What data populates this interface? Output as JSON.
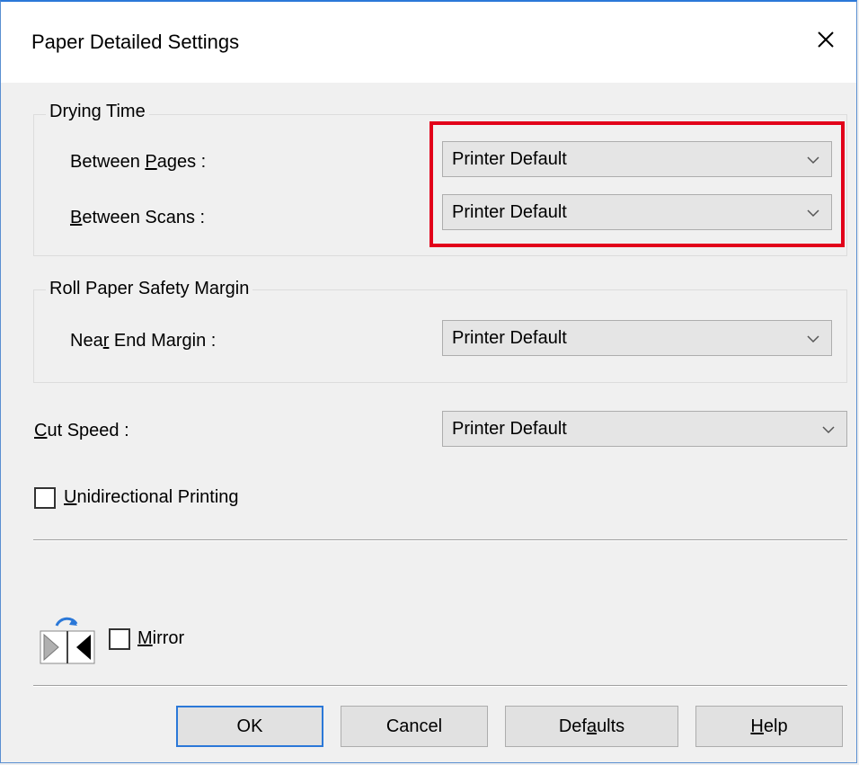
{
  "window": {
    "title": "Paper Detailed Settings"
  },
  "drying_time": {
    "legend": "Drying Time",
    "between_pages": {
      "label_pre": "Between ",
      "label_key": "P",
      "label_post": "ages :",
      "value": "Printer Default"
    },
    "between_scans": {
      "label_pre": "",
      "label_key": "B",
      "label_post": "etween Scans :",
      "value": "Printer Default"
    }
  },
  "roll_paper": {
    "legend": "Roll Paper Safety Margin",
    "near_end": {
      "label_pre": "Nea",
      "label_key": "r",
      "label_post": " End Margin :",
      "value": "Printer Default"
    }
  },
  "cut_speed": {
    "label_pre": "",
    "label_key": "C",
    "label_post": "ut Speed :",
    "value": "Printer Default"
  },
  "unidirectional": {
    "label_pre": "",
    "label_key": "U",
    "label_post": "nidirectional Printing",
    "checked": false
  },
  "mirror": {
    "label_pre": "",
    "label_key": "M",
    "label_post": "irror",
    "checked": false
  },
  "buttons": {
    "ok": "OK",
    "cancel": "Cancel",
    "defaults_pre": "Def",
    "defaults_key": "a",
    "defaults_post": "ults",
    "help_pre": "",
    "help_key": "H",
    "help_post": "elp"
  },
  "colors": {
    "highlight": "#e2001a",
    "accent": "#2b78d8"
  },
  "icons": {
    "close": "close-icon",
    "dropdown": "chevron-down-icon",
    "mirror": "mirror-print-icon"
  }
}
